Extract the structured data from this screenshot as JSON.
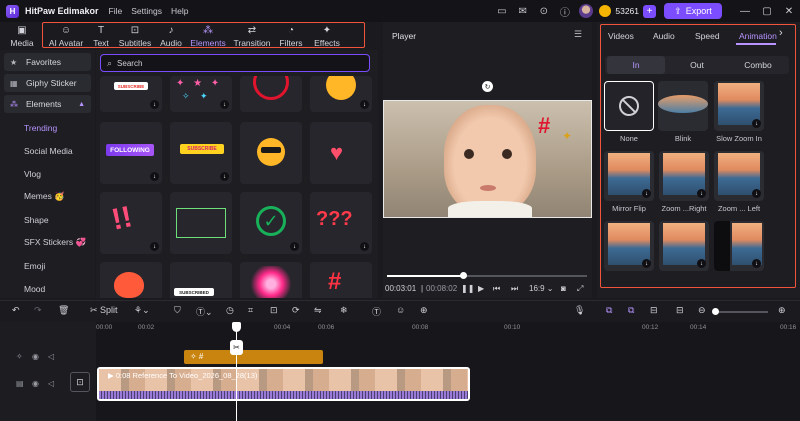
{
  "titlebar": {
    "app_title": "HitPaw Edimakor",
    "menus": [
      "File",
      "Settings",
      "Help"
    ],
    "coins": "53261",
    "export_label": "Export"
  },
  "toolbar": {
    "tools": [
      {
        "label": "Media",
        "icon": "media-icon"
      },
      {
        "label": "AI Avatar",
        "icon": "ai-avatar-icon"
      },
      {
        "label": "Text",
        "icon": "text-icon"
      },
      {
        "label": "Subtitles",
        "icon": "subtitles-icon"
      },
      {
        "label": "Audio",
        "icon": "audio-icon"
      },
      {
        "label": "Elements",
        "icon": "elements-icon"
      },
      {
        "label": "Transition",
        "icon": "transition-icon"
      },
      {
        "label": "Filters",
        "icon": "filters-icon"
      },
      {
        "label": "Effects",
        "icon": "effects-icon"
      }
    ],
    "active": "Elements"
  },
  "sidebar": {
    "top_items": [
      "Favorites",
      "Giphy Sticker",
      "Elements"
    ],
    "sub_items": [
      "Trending",
      "Social Media",
      "Vlog",
      "Memes 🥳",
      "Shape",
      "SFX Stickers 💞",
      "Emoji",
      "Mood"
    ],
    "active_sub": "Trending"
  },
  "content": {
    "search_placeholder": "Search",
    "tiles": [
      {
        "label": "SUBSCRIBE"
      },
      {
        "label": ""
      },
      {
        "label": ""
      },
      {
        "label": ""
      },
      {
        "label": "FOLLOWING"
      },
      {
        "label": "SUBSCRIBE"
      },
      {
        "label": ""
      },
      {
        "label": ""
      },
      {
        "label": "!!"
      },
      {
        "label": ""
      },
      {
        "label": ""
      },
      {
        "label": "???"
      },
      {
        "label": ""
      },
      {
        "label": "SUBSCRIBED"
      },
      {
        "label": ""
      },
      {
        "label": ""
      }
    ]
  },
  "player": {
    "title": "Player",
    "current_time": "00:03:01",
    "total_time": "00:08:02",
    "aspect": "16:9",
    "progress": 0.38
  },
  "right_panel": {
    "tabs": [
      "Videos",
      "Audio",
      "Speed",
      "Animation"
    ],
    "active_tab": "Animation",
    "segments": [
      "In",
      "Out",
      "Combo"
    ],
    "active_segment": "In",
    "animations": [
      "None",
      "Blink",
      "Slow Zoom In",
      "Mirror Flip",
      "Zoom ...Right",
      "Zoom ... Left",
      "",
      "",
      ""
    ]
  },
  "timeline": {
    "split_label": "Split",
    "ruler": [
      "00:00",
      "00:02",
      "00:04",
      "00:06",
      "00:08",
      "00:10",
      "00:12",
      "00:14",
      "00:16"
    ],
    "video_clip_label": "0:08 Reference To Video_2026_08_28(13)"
  },
  "colors": {
    "accent": "#7c4dff",
    "accent_text": "#b794ff",
    "highlight_box": "#f0553c",
    "audio_clip": "#c98410"
  }
}
